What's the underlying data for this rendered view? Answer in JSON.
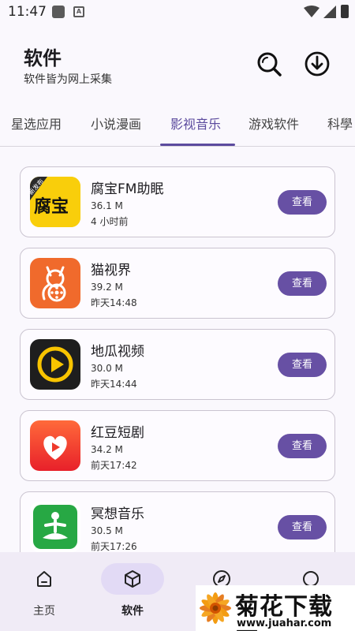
{
  "status_bar": {
    "time": "11:47",
    "a_icon": "A"
  },
  "header": {
    "title": "软件",
    "subtitle": "软件皆为网上采集"
  },
  "tabs": [
    {
      "label": "星选应用",
      "active": false
    },
    {
      "label": "小说漫画",
      "active": false
    },
    {
      "label": "影视音乐",
      "active": true
    },
    {
      "label": "游戏软件",
      "active": false
    },
    {
      "label": "科學",
      "active": false
    }
  ],
  "apps": [
    {
      "name": "腐宝FM助眠",
      "size": "36.1 M",
      "time": "4 小时前",
      "button": "查看",
      "icon_text": "腐宝",
      "icon_badge": "新发布",
      "icon": "fubao-icon"
    },
    {
      "name": "猫视界",
      "size": "39.2 M",
      "time": "昨天14:48",
      "button": "查看",
      "icon": "cat-film-icon"
    },
    {
      "name": "地瓜视频",
      "size": "30.0 M",
      "time": "昨天14:44",
      "button": "查看",
      "icon": "play-circle-icon"
    },
    {
      "name": "红豆短剧",
      "size": "34.2 M",
      "time": "前天17:42",
      "button": "查看",
      "icon": "red-heart-play-icon"
    },
    {
      "name": "冥想音乐",
      "size": "30.5 M",
      "time": "前天17:26",
      "button": "查看",
      "icon": "meditation-icon"
    }
  ],
  "bottom_nav": [
    {
      "label": "主页",
      "icon": "home-icon",
      "active": false
    },
    {
      "label": "软件",
      "icon": "cube-icon",
      "active": true
    },
    {
      "label": "",
      "icon": "compass-icon",
      "active": false
    },
    {
      "label": "",
      "icon": "circle-icon",
      "active": false
    }
  ],
  "watermark": {
    "title": "菊花下载网",
    "url": "www.juahar.com"
  },
  "colors": {
    "accent": "#6750a4",
    "active_tab": "#5c4b9e",
    "nav_bg": "#f0ebf6"
  }
}
